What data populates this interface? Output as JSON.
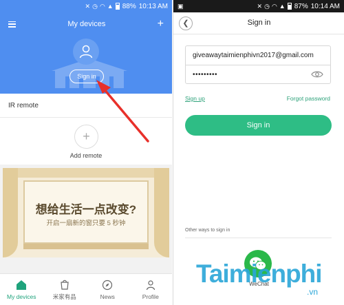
{
  "left_phone": {
    "status": {
      "battery": "88%",
      "time": "10:13 AM"
    },
    "header": {
      "title": "My devices"
    },
    "account": {
      "signin_label": "Sign in"
    },
    "ir_remote_label": "IR remote",
    "add_remote_label": "Add remote",
    "banner": {
      "title": "想给生活一点改变?",
      "subtitle": "开启一扇新的窗只要 5 秒钟"
    },
    "tabs": [
      {
        "label": "My devices",
        "icon": "home-icon",
        "active": true
      },
      {
        "label": "米家有品",
        "icon": "bag-icon",
        "active": false
      },
      {
        "label": "News",
        "icon": "compass-icon",
        "active": false
      },
      {
        "label": "Profile",
        "icon": "person-icon",
        "active": false
      }
    ]
  },
  "right_phone": {
    "status": {
      "battery": "87%",
      "time": "10:14 AM"
    },
    "header": {
      "title": "Sign in"
    },
    "form": {
      "email_value": "giveawaytaimienphivn2017@gmail.com",
      "password_value": "•••••••••"
    },
    "links": {
      "sign_up": "Sign up",
      "forgot_password": "Forgot password"
    },
    "signin_button_label": "Sign in",
    "other_ways_label": "Other ways to sign in",
    "wechat_label": "WeChat"
  },
  "watermark": {
    "text": "Taimienphi",
    "suffix": ".vn"
  },
  "colors": {
    "brand_blue": "#4f8ef0",
    "accent_green": "#2ebd85",
    "tab_active": "#1fa37c",
    "arrow_red": "#e8302a"
  }
}
